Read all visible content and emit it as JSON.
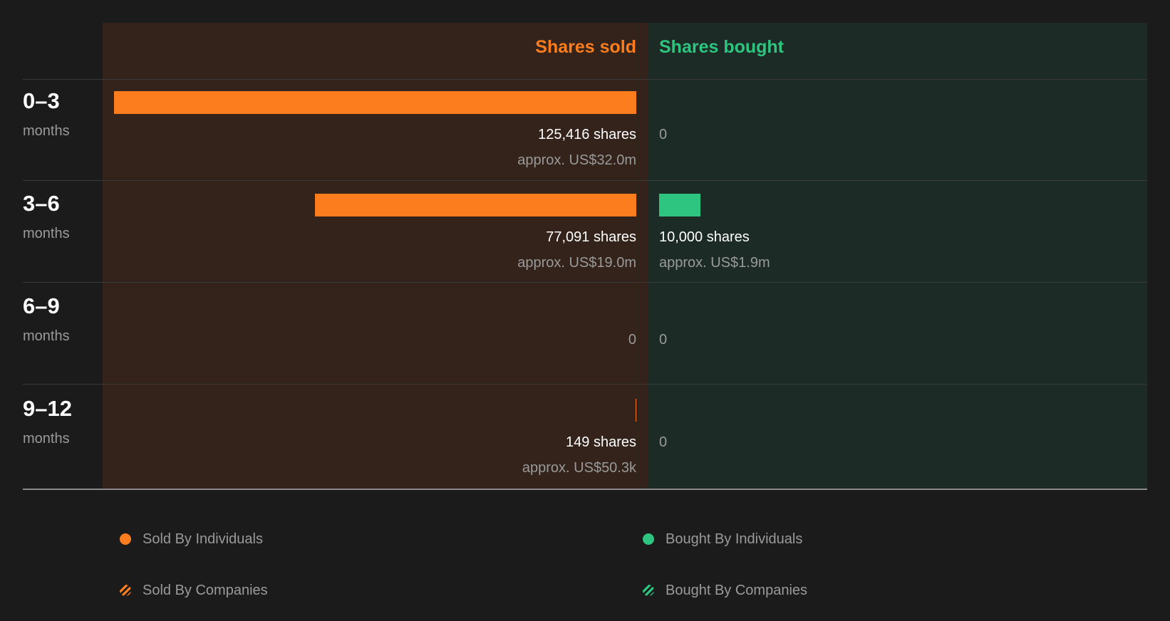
{
  "header": {
    "sold": "Shares sold",
    "bought": "Shares bought"
  },
  "rows": [
    {
      "period": "0–3",
      "unit": "months",
      "sold": {
        "shares": 125416,
        "label": "125,416 shares",
        "approx": "approx. US$32.0m"
      },
      "bought": {
        "shares": 0,
        "label": "0",
        "approx": ""
      }
    },
    {
      "period": "3–6",
      "unit": "months",
      "sold": {
        "shares": 77091,
        "label": "77,091 shares",
        "approx": "approx. US$19.0m"
      },
      "bought": {
        "shares": 10000,
        "label": "10,000 shares",
        "approx": "approx. US$1.9m"
      }
    },
    {
      "period": "6–9",
      "unit": "months",
      "sold": {
        "shares": 0,
        "label": "0",
        "approx": ""
      },
      "bought": {
        "shares": 0,
        "label": "0",
        "approx": ""
      }
    },
    {
      "period": "9–12",
      "unit": "months",
      "sold": {
        "shares": 149,
        "label": "149 shares",
        "approx": "approx. US$50.3k"
      },
      "bought": {
        "shares": 0,
        "label": "0",
        "approx": ""
      }
    }
  ],
  "legend": [
    {
      "label": "Sold By Individuals",
      "style": "solid-orange"
    },
    {
      "label": "Bought By Individuals",
      "style": "solid-green"
    },
    {
      "label": "Sold By Companies",
      "style": "hatched-orange"
    },
    {
      "label": "Bought By Companies",
      "style": "hatched-green"
    }
  ],
  "colors": {
    "sold": "#fb7d1e",
    "bought": "#2dc57f",
    "sold_panel": "#33231b",
    "bought_panel": "#1c2b25",
    "background": "#1b1b1b"
  },
  "chart_data": {
    "type": "bar",
    "categories": [
      "0–3 months",
      "3–6 months",
      "6–9 months",
      "9–12 months"
    ],
    "series": [
      {
        "name": "Shares sold",
        "values": [
          125416,
          77091,
          0,
          149
        ]
      },
      {
        "name": "Shares bought",
        "values": [
          0,
          10000,
          0,
          0
        ]
      }
    ],
    "value_labels": {
      "sold": [
        "approx. US$32.0m",
        "approx. US$19.0m",
        "",
        "approx. US$50.3k"
      ],
      "bought": [
        "",
        "approx. US$1.9m",
        "",
        ""
      ]
    },
    "legend": [
      "Sold By Individuals",
      "Bought By Individuals",
      "Sold By Companies",
      "Bought By Companies"
    ],
    "legend_position": "bottom"
  }
}
